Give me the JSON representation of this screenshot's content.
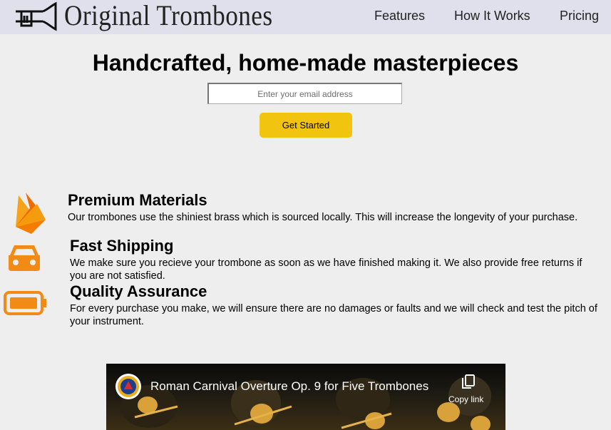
{
  "header": {
    "brand": "Original Trombones",
    "logo_icon": "trombone-icon",
    "nav": [
      {
        "label": "Features"
      },
      {
        "label": "How It Works"
      },
      {
        "label": "Pricing"
      }
    ]
  },
  "hero": {
    "title": "Handcrafted, home-made masterpieces",
    "email_placeholder": "Enter your email address",
    "cta_label": "Get Started",
    "cta_color": "#f1c40f"
  },
  "features": [
    {
      "icon": "fire-icon",
      "title": "Premium Materials",
      "description": "Our trombones use the shiniest brass which is sourced locally. This will increase the longevity of your purchase."
    },
    {
      "icon": "truck-icon",
      "title": "Fast Shipping",
      "description": "We make sure you recieve your trombone as soon as we have finished making it. We also provide free returns if you are not satisfied."
    },
    {
      "icon": "battery-full-icon",
      "title": "Quality Assurance",
      "description": "For every purchase you make, we will ensure there are no damages or faults and we will check and test the pitch of your instrument."
    }
  ],
  "accent_color": "#f28b15",
  "header_bg": "#e0e0ed",
  "video": {
    "title": "Roman Carnival Overture Op. 9 for Five Trombones",
    "copy_label": "Copy link"
  }
}
